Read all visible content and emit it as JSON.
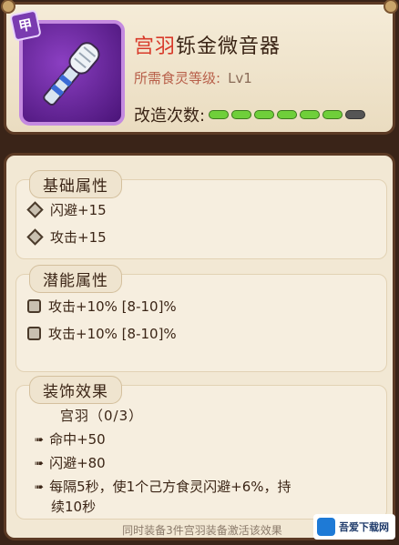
{
  "item": {
    "badge": "甲",
    "name_prefix": "宫羽",
    "name_rest": "铄金微音器",
    "requirement_label": "所需食灵等级:",
    "requirement_value": "Lv1",
    "modify_label": "改造次数:",
    "modify_progress": {
      "filled": 6,
      "total": 7
    }
  },
  "sections": {
    "base": {
      "title": "基础属性",
      "lines": [
        "闪避+15",
        "攻击+15"
      ]
    },
    "potential": {
      "title": "潜能属性",
      "lines": [
        "攻击+10% [8-10]%",
        "攻击+10% [8-10]%"
      ]
    },
    "decor": {
      "title": "装饰效果",
      "set_name": "宫羽（0/3）",
      "lines": [
        "命中+50",
        "闪避+80",
        "每隔5秒，使1个己方食灵闪避+6%，持",
        "续10秒"
      ],
      "note": "同时装备3件宫羽装备激活该效果"
    }
  },
  "watermark": {
    "text": "吾爱下载网"
  },
  "colors": {
    "accent_red": "#d83a2a",
    "pip_on": "#6fcf3a",
    "pip_off": "#555555",
    "frame_purple": "#8b3fc2"
  }
}
